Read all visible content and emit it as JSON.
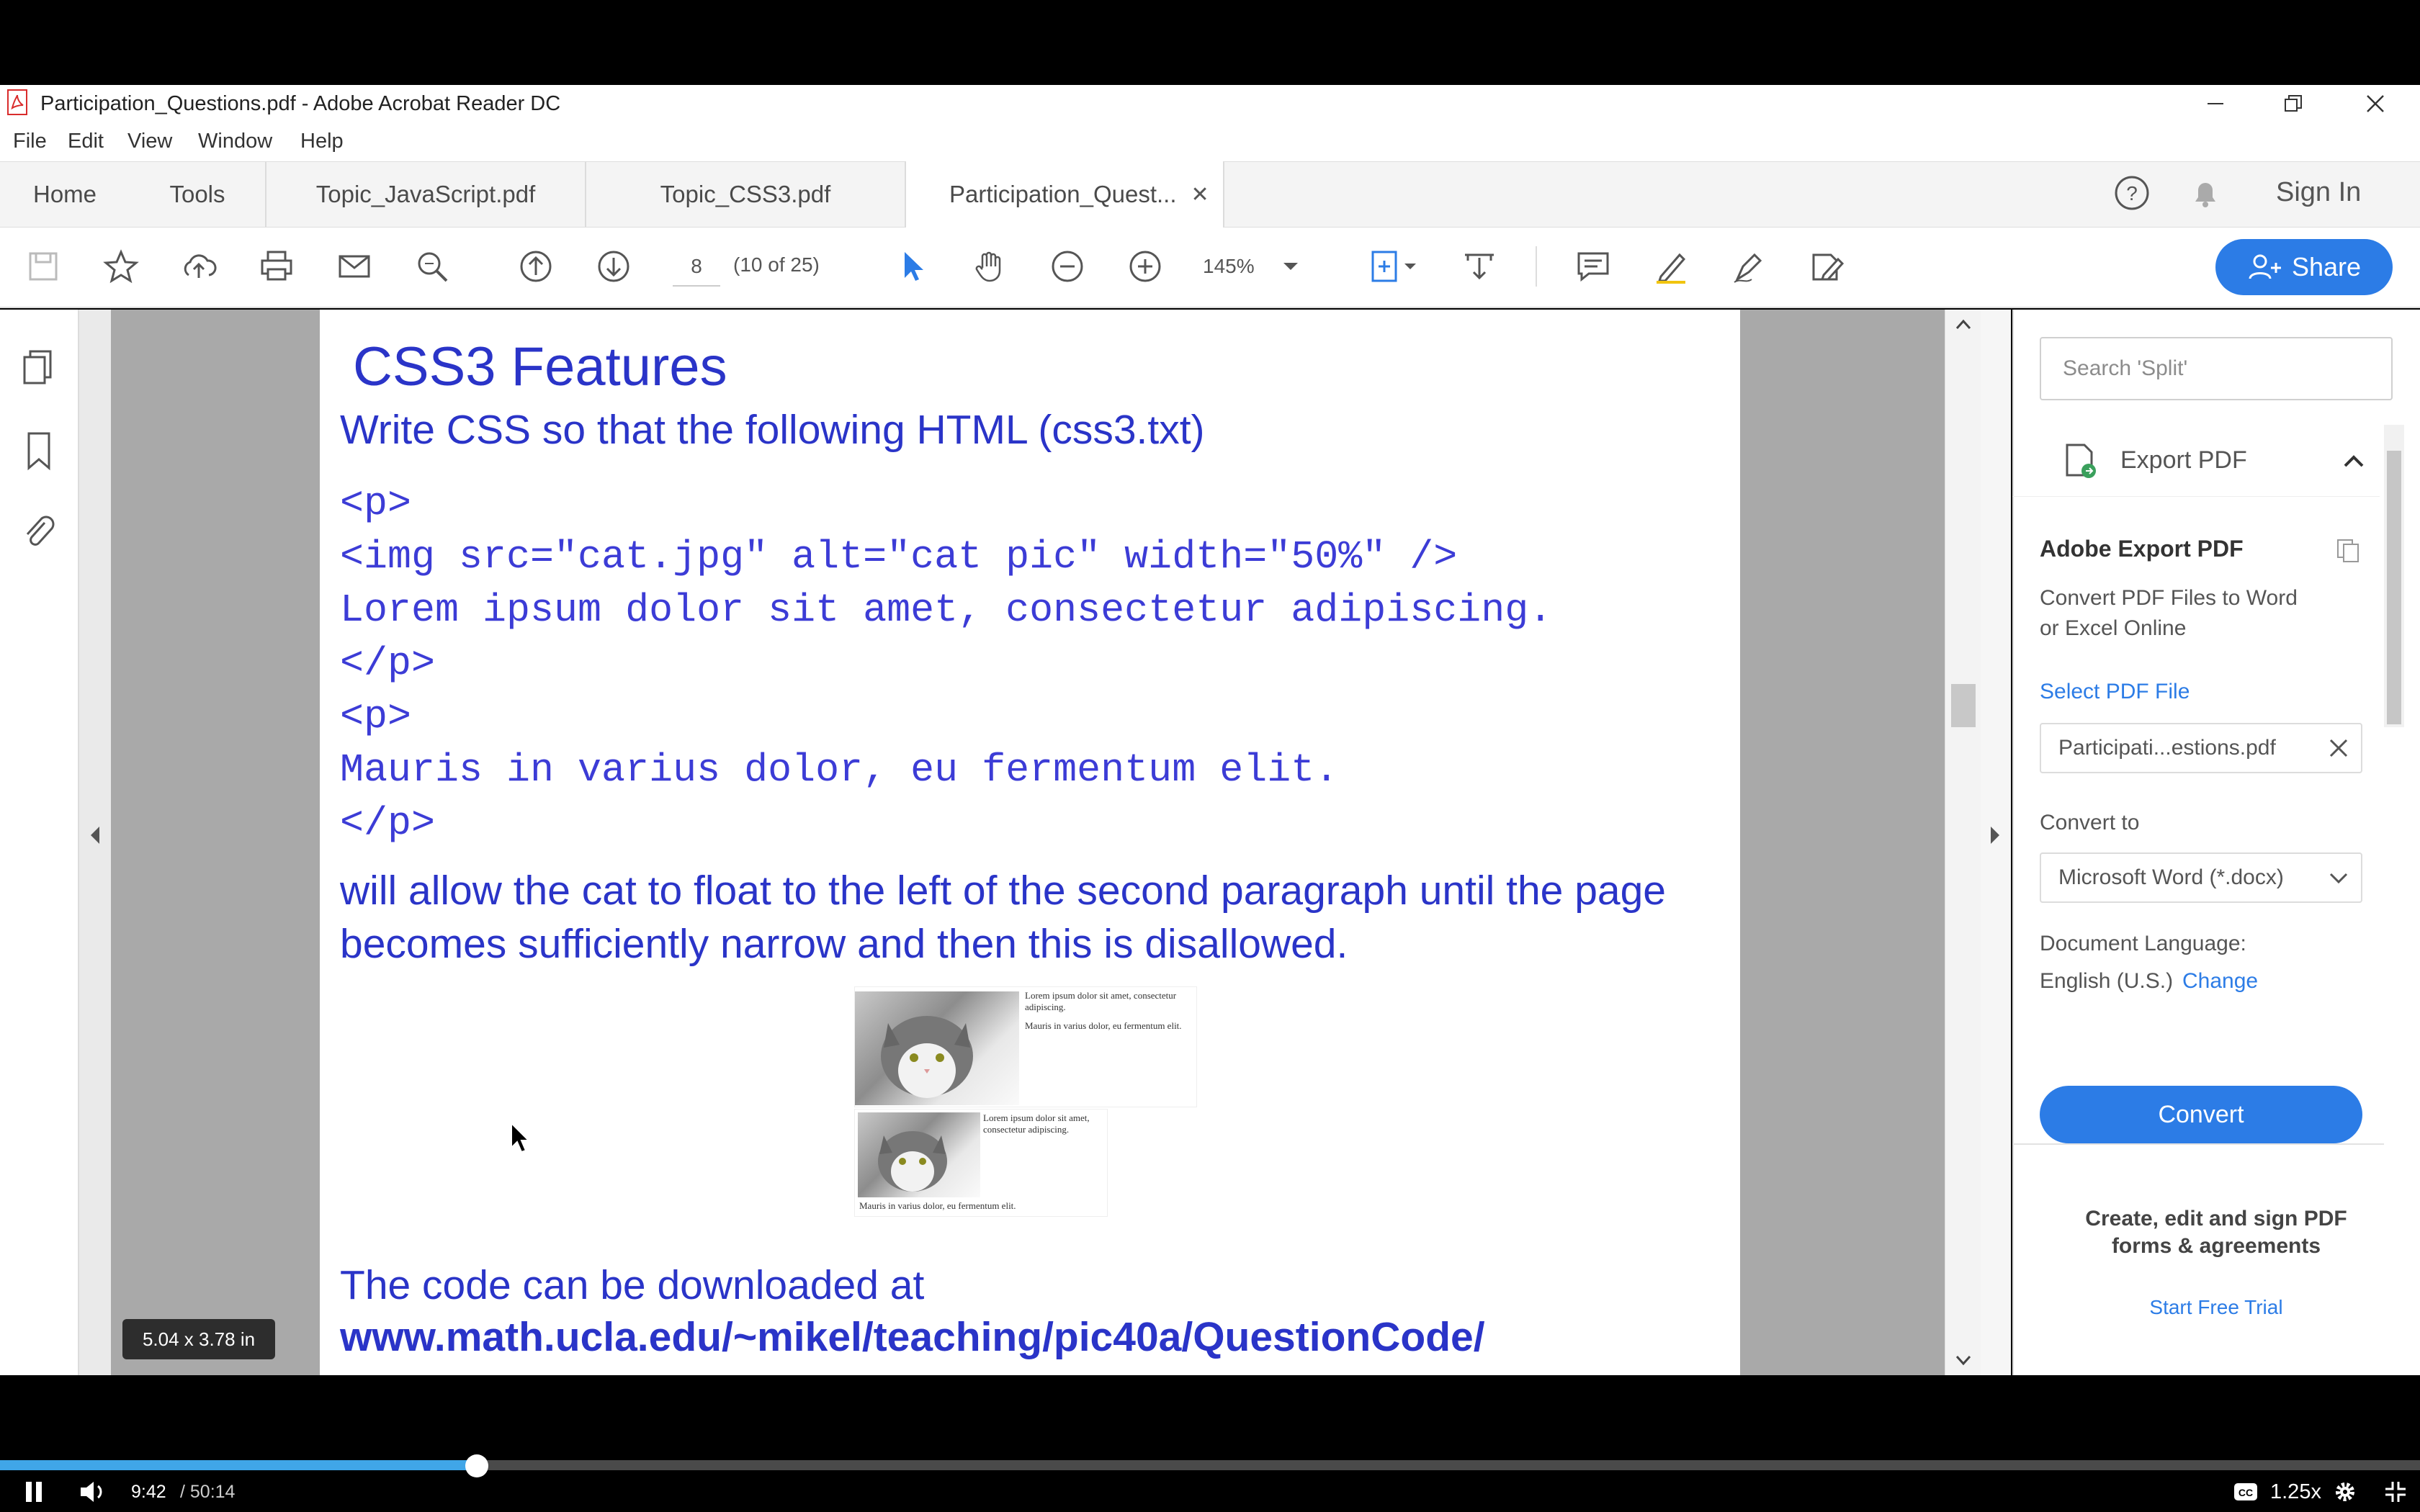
{
  "window": {
    "title": "Participation_Questions.pdf - Adobe Acrobat Reader DC"
  },
  "menu": [
    "File",
    "Edit",
    "View",
    "Window",
    "Help"
  ],
  "tabs": {
    "home": "Home",
    "tools": "Tools",
    "doc1": "Topic_JavaScript.pdf",
    "doc2": "Topic_CSS3.pdf",
    "doc3": "Participation_Quest...",
    "sign_in": "Sign In"
  },
  "toolbar": {
    "page_number": "8",
    "page_of": "(10 of 25)",
    "zoom": "145%",
    "share": "Share"
  },
  "document": {
    "heading": "CSS3 Features",
    "intro": "Write CSS so that the following HTML (css3.txt)",
    "code_lines": [
      "<p>",
      "<img src=\"cat.jpg\" alt=\"cat pic\" width=\"50%\" />",
      "Lorem ipsum dolor sit amet, consectetur adipiscing.",
      "</p>",
      "<p>",
      "Mauris in varius dolor, eu fermentum elit.",
      "</p>"
    ],
    "explain_1": "will allow the cat to float to the left of the second paragraph until the page",
    "explain_2": "becomes sufficiently narrow and then this is disallowed.",
    "thumb_text_1": "Lorem ipsum dolor sit amet, consectetur adipiscing.",
    "thumb_text_2": "Mauris in varius dolor, eu fermentum elit.",
    "thumb_text_3": "Lorem ipsum dolor sit amet, consectetur adipiscing.",
    "thumb_text_4": "Mauris in varius dolor, eu fermentum elit.",
    "download_1": "The code can be downloaded at",
    "download_url": "www.math.ucla.edu/~mikel/teaching/pic40a/QuestionCode/",
    "size_badge": "5.04 x 3.78 in"
  },
  "right_panel": {
    "search_placeholder": "Search 'Split'",
    "export_header": "Export PDF",
    "adobe_export": "Adobe Export PDF",
    "convert_desc_1": "Convert PDF Files to Word",
    "convert_desc_2": "or Excel Online",
    "select_file": "Select PDF File",
    "file_name": "Participati...estions.pdf",
    "convert_to": "Convert to",
    "format": "Microsoft Word (*.docx)",
    "doc_language": "Document Language:",
    "language": "English (U.S.)",
    "change": "Change",
    "convert_btn": "Convert",
    "promo_1": "Create, edit and sign PDF",
    "promo_2": "forms & agreements",
    "trial": "Start Free Trial"
  },
  "video": {
    "current_time": "9:42",
    "duration": "/ 50:14",
    "speed": "1.25x",
    "progress": 0.197
  },
  "colors": {
    "accent": "#2c7ce6",
    "doc_text": "#2a34c8",
    "progress": "#40a6e8"
  }
}
